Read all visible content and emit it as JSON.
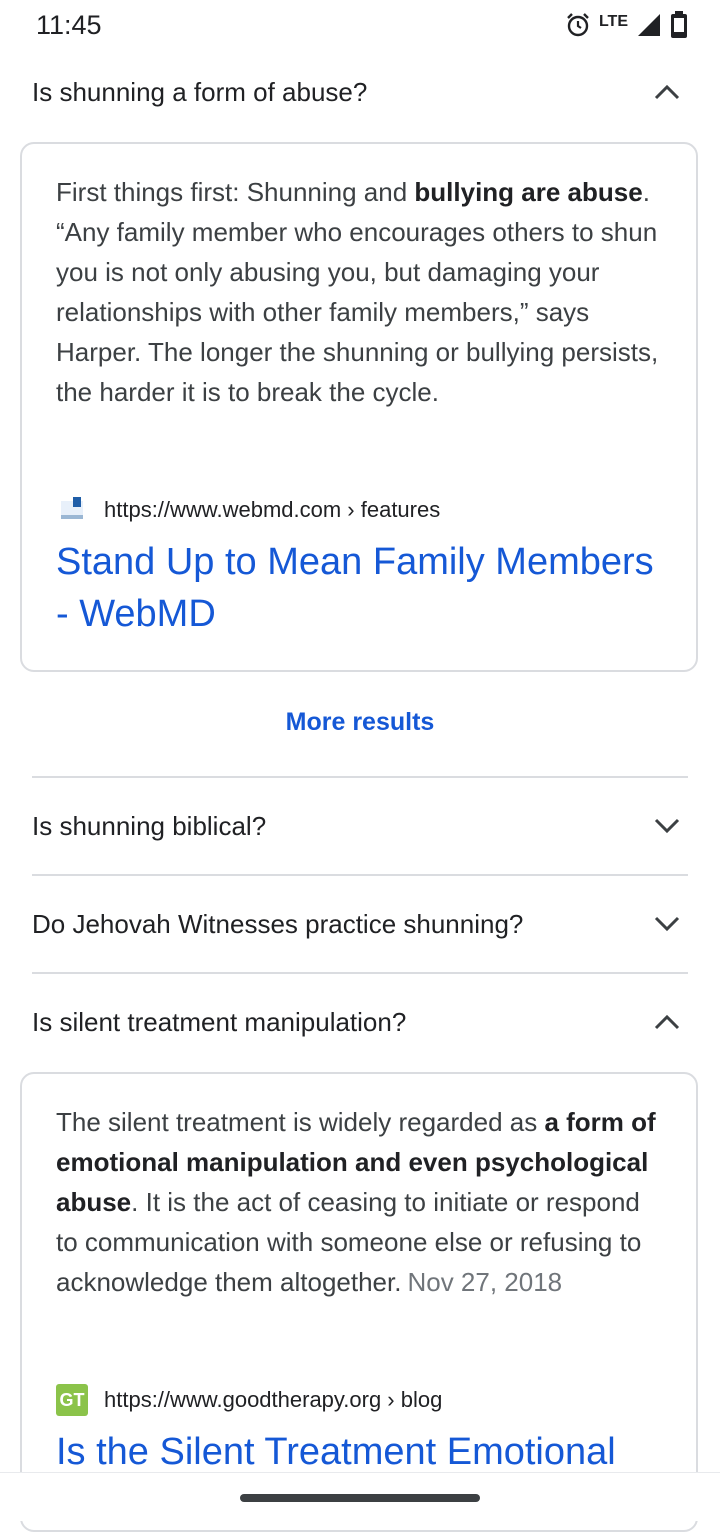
{
  "status_bar": {
    "time": "11:45",
    "network": "LTE",
    "icons": [
      "alarm-icon",
      "signal-icon",
      "battery-icon"
    ]
  },
  "faq": [
    {
      "question": "Is shunning a form of abuse?",
      "expanded": true,
      "answer_parts": [
        {
          "text": "First things first: Shunning and ",
          "bold": false
        },
        {
          "text": "bullying are abuse",
          "bold": true
        },
        {
          "text": ". “Any family member who encourages others to shun you is not only abusing you, but damaging your relationships with other family members,” says Harper. The longer the shunning or bullying persists, the harder it is to break the cycle.",
          "bold": false
        }
      ],
      "source_url": "https://www.webmd.com › features",
      "result_title": "Stand Up to Mean Family Members - WebMD"
    },
    {
      "question": "Is shunning biblical?",
      "expanded": false
    },
    {
      "question": "Do Jehovah Witnesses practice shunning?",
      "expanded": false
    },
    {
      "question": "Is silent treatment manipulation?",
      "expanded": true,
      "answer_parts": [
        {
          "text": "The silent treatment is widely regarded as ",
          "bold": false
        },
        {
          "text": "a form of emotional manipulation and even psychological abuse",
          "bold": true
        },
        {
          "text": ". It is the act of ceasing to initiate or respond to communication with someone else or refusing to acknowledge them altogether.",
          "bold": false
        }
      ],
      "date": "Nov 27, 2018",
      "source_url": "https://www.goodtherapy.org › blog",
      "favicon_text": "GT",
      "result_title": "Is the Silent Treatment Emotional"
    }
  ],
  "more_results_label": "More results",
  "colors": {
    "link": "#1558d6",
    "divider": "#dadce0",
    "gt_favicon": "#8bc34a"
  }
}
